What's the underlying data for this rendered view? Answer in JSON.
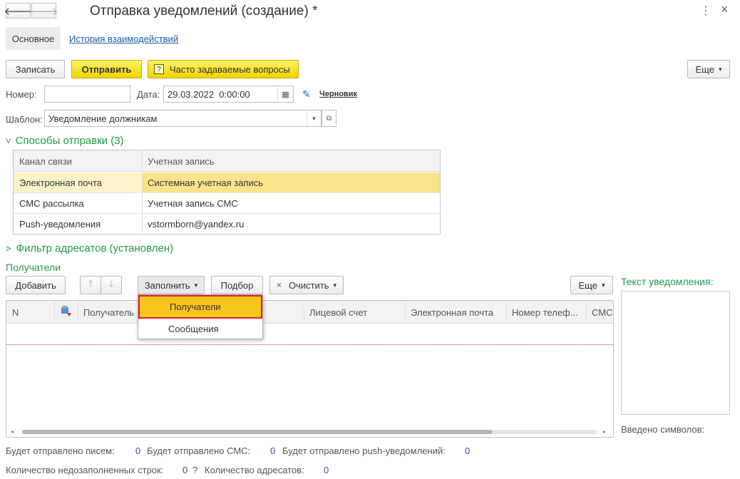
{
  "window": {
    "title": "Отправка уведомлений (создание) *",
    "back_icon": "arrow-left-icon",
    "forward_icon": "arrow-right-icon",
    "menu_glyph": "⋮",
    "close_glyph": "×"
  },
  "tabs": {
    "main": "Основное",
    "history": "История взаимодействий"
  },
  "toolbar": {
    "save": "Записать",
    "send": "Отправить",
    "faq": "Часто задаваемые вопросы",
    "faq_icon_glyph": "?",
    "more": "Еще"
  },
  "form": {
    "number_label": "Номер:",
    "number_value": "",
    "date_label": "Дата:",
    "date_value": "29.03.2022  0:00:00",
    "status": "Черновик",
    "template_label": "Шаблон:",
    "template_value": "Уведомление должникам"
  },
  "methods": {
    "title": "Способы отправки (3)",
    "columns": [
      "Канал связи",
      "Учетная запись"
    ],
    "rows": [
      {
        "channel": "Электронная почта",
        "account": "Системная учетная запись"
      },
      {
        "channel": "СМС рассылка",
        "account": "Учетная запись СМС"
      },
      {
        "channel": "Push-уведомления",
        "account": "vstormborn@yandex.ru"
      }
    ]
  },
  "filter": {
    "title": "Фильтр адресатов (установлен)"
  },
  "recipients": {
    "title": "Получатели",
    "add": "Добавить",
    "fill": "Заполнить",
    "pick": "Подбор",
    "clear": "Очистить",
    "clear_glyph": "×",
    "more": "Еще",
    "columns": [
      "N",
      "",
      "Получатель",
      "",
      "Лицевой счет",
      "Электронная почта",
      "Номер телеф...",
      "СМС"
    ]
  },
  "fill_menu": {
    "items": [
      "Получатели",
      "Сообщения"
    ]
  },
  "message": {
    "title": "Текст уведомления:",
    "chars_label": "Введено символов:"
  },
  "summary": {
    "letters_label": "Будет отправлено писем:",
    "letters_value": "0",
    "sms_label": "Будет отправлено СМС:",
    "sms_value": "0",
    "push_label": "Будет отправлено push-уведомлений:",
    "push_value": "0",
    "incomplete_label": "Количество недозаполненных строк:",
    "incomplete_value": "0",
    "incomplete_hint": "?",
    "recipients_label": "Количество адресатов:",
    "recipients_value": "0"
  },
  "colors": {
    "accent_green": "#1f9a47",
    "highlight_yellow": "#fbe38b",
    "menu_border_red": "#e02020",
    "value_blue": "#1a5aa8"
  }
}
